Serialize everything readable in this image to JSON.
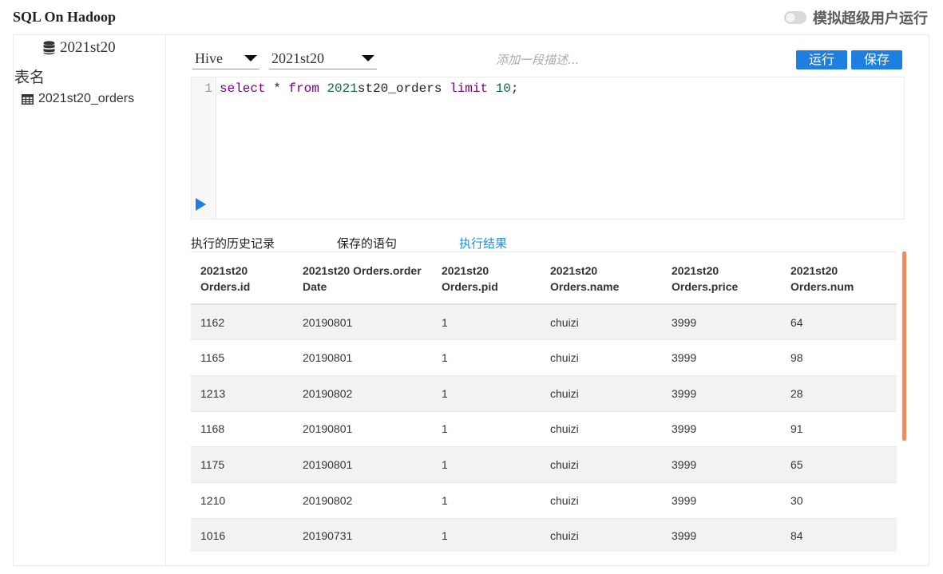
{
  "app": {
    "title": "SQL On Hadoop"
  },
  "super_user": {
    "label": "模拟超级用户运行",
    "enabled": false
  },
  "sidebar": {
    "database": "2021st20",
    "tables_heading": "表名",
    "tables": [
      "2021st20_orders"
    ]
  },
  "toolbar": {
    "engine": "Hive",
    "database": "2021st20",
    "description_placeholder": "添加一段描述...",
    "run_label": "运行",
    "save_label": "保存"
  },
  "editor": {
    "line_number": "1",
    "tokens": [
      {
        "text": "select",
        "type": "kw"
      },
      {
        "text": " * ",
        "type": "plain"
      },
      {
        "text": "from",
        "type": "kw"
      },
      {
        "text": " ",
        "type": "plain"
      },
      {
        "text": "2021",
        "type": "num"
      },
      {
        "text": "st20_orders ",
        "type": "plain"
      },
      {
        "text": "limit",
        "type": "kw"
      },
      {
        "text": " ",
        "type": "plain"
      },
      {
        "text": "10",
        "type": "num"
      },
      {
        "text": ";",
        "type": "plain"
      }
    ]
  },
  "tabs": [
    {
      "label": "执行的历史记录",
      "active": false
    },
    {
      "label": "保存的语句",
      "active": false
    },
    {
      "label": "执行结果",
      "active": true
    }
  ],
  "results": {
    "columns": [
      [
        "2021st20",
        "Orders.id"
      ],
      [
        "2021st20 Orders.order",
        "Date"
      ],
      [
        "2021st20",
        "Orders.pid"
      ],
      [
        "2021st20",
        "Orders.name"
      ],
      [
        "2021st20",
        "Orders.price"
      ],
      [
        "2021st20",
        "Orders.num"
      ]
    ],
    "rows": [
      [
        "1162",
        "20190801",
        "1",
        "chuizi",
        "3999",
        "64"
      ],
      [
        "1165",
        "20190801",
        "1",
        "chuizi",
        "3999",
        "98"
      ],
      [
        "1213",
        "20190802",
        "1",
        "chuizi",
        "3999",
        "28"
      ],
      [
        "1168",
        "20190801",
        "1",
        "chuizi",
        "3999",
        "91"
      ],
      [
        "1175",
        "20190801",
        "1",
        "chuizi",
        "3999",
        "65"
      ],
      [
        "1210",
        "20190802",
        "1",
        "chuizi",
        "3999",
        "30"
      ],
      [
        "1016",
        "20190731",
        "1",
        "chuizi",
        "3999",
        "84"
      ]
    ]
  },
  "colors": {
    "primary": "#1e7fe0",
    "active_tab": "#1e8fe6",
    "scrollbar": "#f08a62"
  }
}
